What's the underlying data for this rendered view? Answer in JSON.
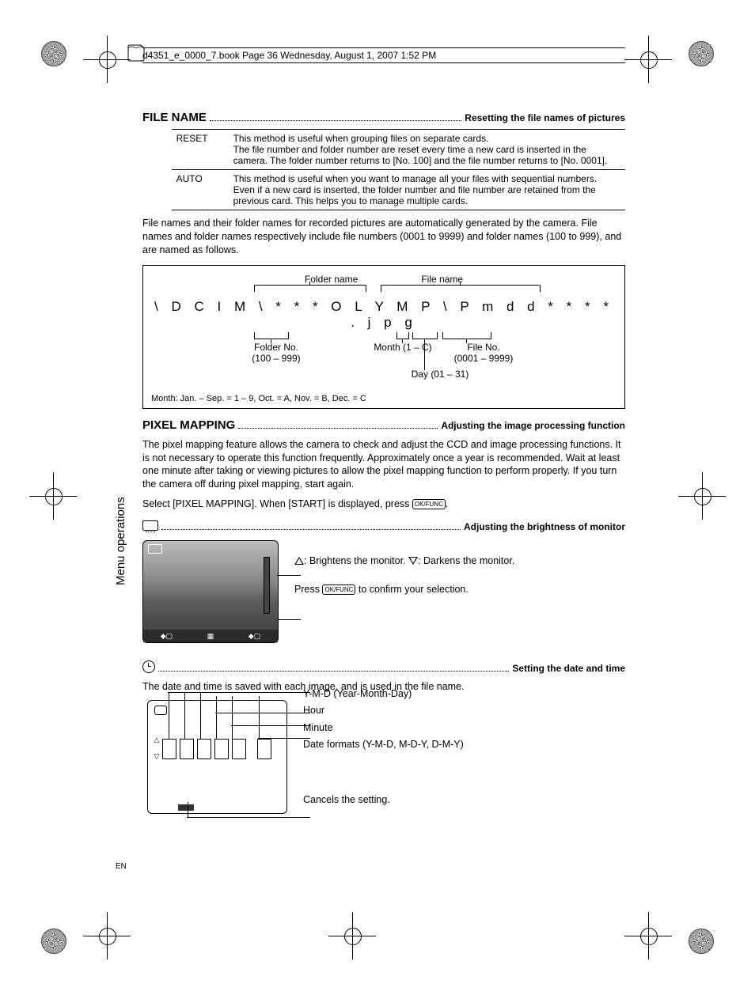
{
  "header": "d4351_e_0000_7.book  Page 36  Wednesday, August 1, 2007  1:52 PM",
  "sidebar": "Menu operations",
  "footer": "EN",
  "filename": {
    "title": "FILE NAME",
    "subtitle": "Resetting the file names of pictures",
    "reset_label": "RESET",
    "reset_text": "This method is useful when grouping files on separate cards.\nThe file number and folder number are reset every time a new card is inserted in the camera. The folder number returns to [No. 100] and the file number returns to [No. 0001].",
    "auto_label": "AUTO",
    "auto_text": "This method is useful when you want to manage all your files with sequential numbers.\nEven if a new card is inserted, the folder number and file number are retained from the previous card. This helps you to manage multiple cards.",
    "para": "File names and their folder names for recorded pictures are automatically generated by the camera. File names and folder names respectively include file numbers (0001 to 9999) and folder names (100 to 999), and are named as follows.",
    "lbl_folder_name": "Folder name",
    "lbl_file_name": "File name",
    "path": "\\ D C I M \\ * * * O L Y M P \\ P m d d * * * * . j p g",
    "lbl_folder_no": "Folder No.",
    "lbl_folder_range": "(100 – 999)",
    "lbl_month": "Month (1 – C)",
    "lbl_file_no": "File No.",
    "lbl_file_range": "(0001 – 9999)",
    "lbl_day": "Day (01 – 31)",
    "month_note": "Month: Jan. – Sep. = 1 – 9, Oct. = A, Nov. = B, Dec. = C"
  },
  "pixelmapping": {
    "title": "PIXEL MAPPING",
    "subtitle": "Adjusting the image processing function",
    "para": "The pixel mapping feature allows the camera to check and adjust the CCD and image processing functions. It is not necessary to operate this function frequently. Approximately once a year is recommended. Wait at least one minute after taking or viewing pictures to allow the pixel mapping function to perform properly. If you turn the camera off during pixel mapping, start again.",
    "instr_pre": "Select [PIXEL MAPPING]. When [START] is displayed, press ",
    "btn": "OK/FUNC",
    "instr_post": "."
  },
  "brightness": {
    "subtitle": "Adjusting the brightness of monitor",
    "annot1_pre": ": Brightens the monitor. ",
    "annot1_post": ": Darkens the monitor.",
    "annot2_pre": "Press ",
    "annot2_btn": "OK/FUNC",
    "annot2_post": " to confirm your selection."
  },
  "datetime": {
    "subtitle": "Setting the date and time",
    "para": "The date and time is saved with each image, and is used in the file name.",
    "l1": "Y-M-D (Year-Month-Day)",
    "l2": "Hour",
    "l3": "Minute",
    "l4": "Date formats (Y-M-D, M-D-Y, D-M-Y)",
    "l5": "Cancels the setting."
  }
}
